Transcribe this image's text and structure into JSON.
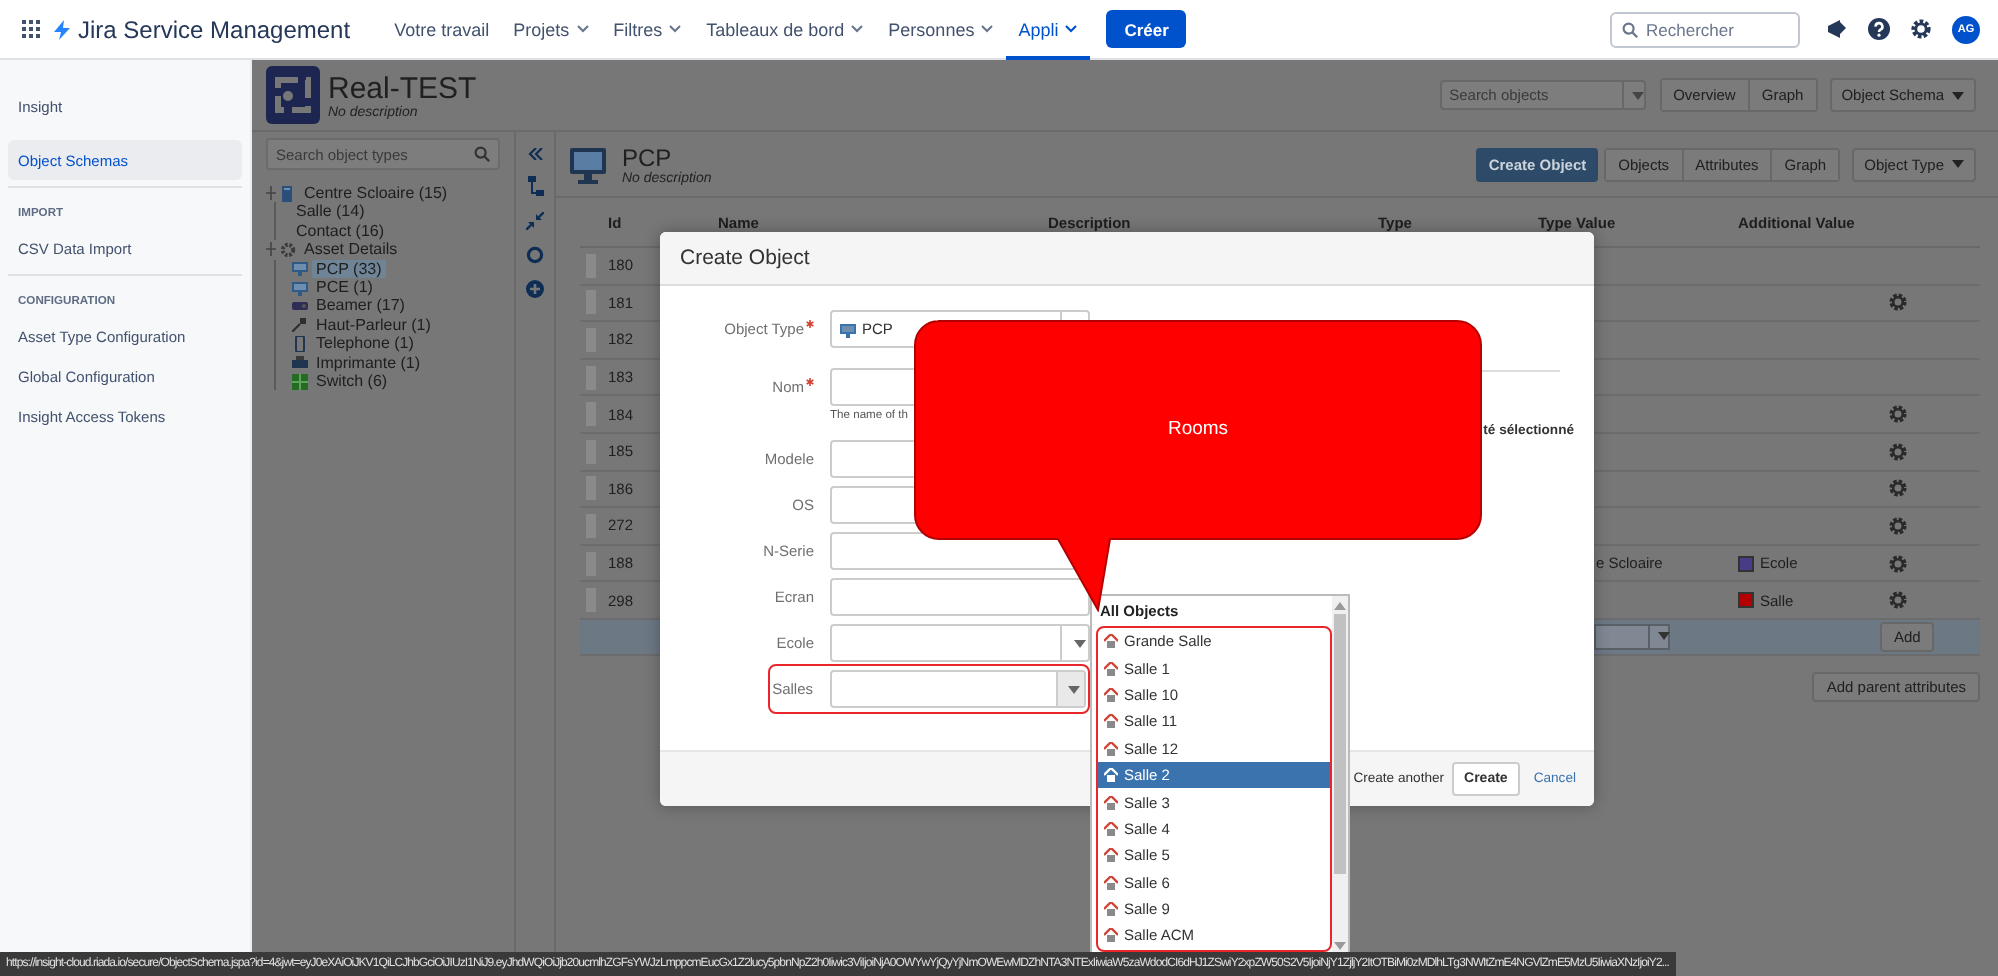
{
  "nav": {
    "app_name": "Jira Service Management",
    "items": [
      {
        "label": "Votre travail",
        "dropdown": false,
        "selected": false
      },
      {
        "label": "Projets",
        "dropdown": true,
        "selected": false
      },
      {
        "label": "Filtres",
        "dropdown": true,
        "selected": false
      },
      {
        "label": "Tableaux de bord",
        "dropdown": true,
        "selected": false
      },
      {
        "label": "Personnes",
        "dropdown": true,
        "selected": false
      },
      {
        "label": "Appli",
        "dropdown": true,
        "selected": true
      }
    ],
    "create_button": "Créer",
    "search": {
      "placeholder": "Rechercher"
    },
    "avatar": "AG"
  },
  "sidebar": {
    "title": "Insight",
    "sections": [
      {
        "items": [
          {
            "label": "Object Schemas",
            "selected": true
          }
        ]
      },
      {
        "heading": "IMPORT",
        "items": [
          {
            "label": "CSV Data Import",
            "selected": false
          }
        ]
      },
      {
        "heading": "CONFIGURATION",
        "items": [
          {
            "label": "Asset Type Configuration",
            "selected": false
          },
          {
            "label": "Global Configuration",
            "selected": false
          },
          {
            "label": "Insight Access Tokens",
            "selected": false
          }
        ]
      }
    ]
  },
  "schema": {
    "title": "Real-TEST",
    "description": "No description",
    "search": {
      "placeholder": "Search objects"
    },
    "views": [
      {
        "label": "Overview",
        "selected": false
      },
      {
        "label": "Graph",
        "selected": false
      }
    ],
    "menu_button": "Object Schema"
  },
  "tree_search": {
    "placeholder": "Search object types"
  },
  "tree": [
    {
      "label": "Centre Scloaire (15)",
      "kind": "book",
      "selected": false,
      "children": [
        {
          "label": "Salle (14)",
          "kind": "none",
          "selected": false
        },
        {
          "label": "Contact (16)",
          "kind": "none",
          "selected": false
        }
      ]
    },
    {
      "label": "Asset Details",
      "kind": "gear",
      "selected": false,
      "children": [
        {
          "label": "PCP (33)",
          "kind": "monitor",
          "selected": true
        },
        {
          "label": "PCE (1)",
          "kind": "monitor",
          "selected": false
        },
        {
          "label": "Beamer (17)",
          "kind": "beamer",
          "selected": false
        },
        {
          "label": "Haut-Parleur (1)",
          "kind": "speaker",
          "selected": false
        },
        {
          "label": "Telephone (1)",
          "kind": "phone",
          "selected": false
        },
        {
          "label": "Imprimante (1)",
          "kind": "printer",
          "selected": false
        },
        {
          "label": "Switch (6)",
          "kind": "switch",
          "selected": false
        }
      ]
    }
  ],
  "object_type": {
    "title": "PCP",
    "description": "No description",
    "create_button": "Create Object",
    "tabs": [
      {
        "label": "Objects",
        "selected": false
      },
      {
        "label": "Attributes",
        "selected": false
      },
      {
        "label": "Graph",
        "selected": false
      }
    ],
    "menu_button": "Object Type"
  },
  "table": {
    "columns": [
      "Id",
      "Name",
      "Description",
      "Type",
      "Type Value",
      "Additional Value"
    ],
    "rows": [
      {
        "id": "180",
        "actions": false
      },
      {
        "id": "181",
        "actions": true
      },
      {
        "id": "182",
        "actions": false
      },
      {
        "id": "183",
        "actions": false
      },
      {
        "id": "184",
        "actions": true
      },
      {
        "id": "185",
        "actions": true
      },
      {
        "id": "186",
        "actions": true
      },
      {
        "id": "272",
        "actions": true
      },
      {
        "id": "188",
        "actions": true,
        "type_value": "e Scloaire",
        "additional_value": {
          "label": "Ecole",
          "color": "#4a3b87"
        }
      },
      {
        "id": "298",
        "actions": true,
        "additional_value": {
          "label": "Salle",
          "color": "#b30000"
        }
      }
    ],
    "add_button": "Add",
    "add_parent_button": "Add parent attributes"
  },
  "modal": {
    "title": "Create Object",
    "fields": [
      {
        "label": "Object Type",
        "required": true,
        "kind": "select",
        "value": "PCP",
        "highlighted": false
      },
      {
        "label": "Nom",
        "required": true,
        "kind": "text",
        "hint": "The name of th",
        "highlighted": false
      },
      {
        "label": "Modele",
        "required": false,
        "kind": "text",
        "highlighted": false
      },
      {
        "label": "OS",
        "required": false,
        "kind": "text",
        "highlighted": false
      },
      {
        "label": "N-Serie",
        "required": false,
        "kind": "text",
        "highlighted": false
      },
      {
        "label": "Ecran",
        "required": false,
        "kind": "text",
        "highlighted": false
      },
      {
        "label": "Ecole",
        "required": false,
        "kind": "select",
        "highlighted": false
      },
      {
        "label": "Salles",
        "required": false,
        "kind": "select",
        "highlighted": true
      }
    ],
    "side_text": "té sélectionné",
    "create_another": "Create another",
    "create_button": "Create",
    "cancel_link": "Cancel"
  },
  "dropdown": {
    "header": "All Objects",
    "highlighted": true,
    "items": [
      {
        "label": "Grande Salle",
        "selected": false
      },
      {
        "label": "Salle 1",
        "selected": false
      },
      {
        "label": "Salle 10",
        "selected": false
      },
      {
        "label": "Salle 11",
        "selected": false
      },
      {
        "label": "Salle 12",
        "selected": false
      },
      {
        "label": "Salle 2",
        "selected": true
      },
      {
        "label": "Salle 3",
        "selected": false
      },
      {
        "label": "Salle 4",
        "selected": false
      },
      {
        "label": "Salle 5",
        "selected": false
      },
      {
        "label": "Salle 6",
        "selected": false
      },
      {
        "label": "Salle 9",
        "selected": false
      },
      {
        "label": "Salle ACM",
        "selected": false
      }
    ]
  },
  "callout": {
    "text": "Rooms"
  },
  "status_url": "https://insight-cloud.riada.io/secure/ObjectSchema.jspa?id=4&jwt=eyJ0eXAiOiJKV1QiLCJhbGciOiJIUzI1NiJ9.eyJhdWQiOiJjb20ucmlhZGFsYWJzLmppcmEucGx1Z2lucy5pbnNpZ2h0Iiwic3ViIjoiNjA0OWYwYjQyYjNmOWEwMDZhNTA3NTExIiwiaW5zaWdodCI6dHJ1ZSwiY2xpZW50S2V5IjoiNjY1ZjljY2ItOTBiMi0zMDlhLTg3NWItZmE4NGVlZmE5MzU5IiwiaXNzIjoiY2..."
}
